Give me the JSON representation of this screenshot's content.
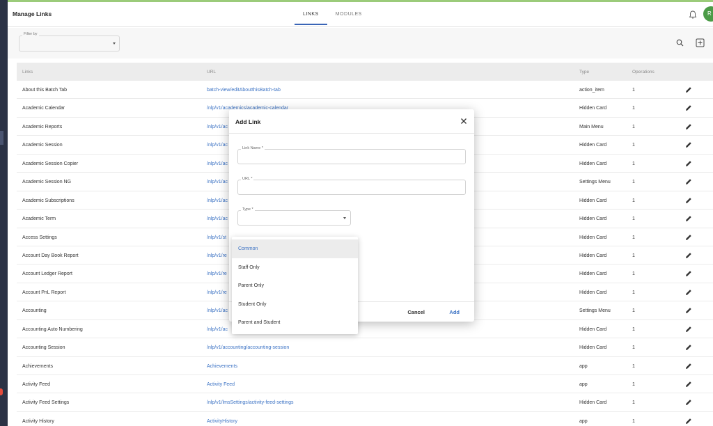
{
  "header": {
    "title": "Manage Links",
    "tabs": [
      {
        "label": "LINKS"
      },
      {
        "label": "MODULES"
      }
    ],
    "avatar_initial": "R"
  },
  "filter": {
    "label": "Filter by"
  },
  "table": {
    "columns": [
      "Links",
      "URL",
      "Type",
      "Operations"
    ],
    "rows": [
      {
        "name": "About this Batch Tab",
        "url": "batch-view/editAboutthisBatch-tab",
        "type": "action_item",
        "ops": "1"
      },
      {
        "name": "Academic Calendar",
        "url": "/nlp/v1/academics/academic-calendar",
        "type": "Hidden Card",
        "ops": "1"
      },
      {
        "name": "Academic Reports",
        "url": "/nlp/v1/ac",
        "type": "Main Menu",
        "ops": "1"
      },
      {
        "name": "Academic Session",
        "url": "/nlp/v1/ac",
        "type": "Hidden Card",
        "ops": "1"
      },
      {
        "name": "Academic Session Copier",
        "url": "/nlp/v1/ac",
        "type": "Hidden Card",
        "ops": "1"
      },
      {
        "name": "Academic Session NG",
        "url": "/nlp/v1/ac",
        "type": "Settings Menu",
        "ops": "1"
      },
      {
        "name": "Academic Subscriptions",
        "url": "/nlp/v1/ac",
        "type": "Hidden Card",
        "ops": "1"
      },
      {
        "name": "Academic Term",
        "url": "/nlp/v1/ac",
        "type": "Hidden Card",
        "ops": "1"
      },
      {
        "name": "Access Settings",
        "url": "/nlp/v1/st",
        "type": "Hidden Card",
        "ops": "1"
      },
      {
        "name": "Account Day Book Report",
        "url": "/nlp/v1/re",
        "type": "Hidden Card",
        "ops": "1"
      },
      {
        "name": "Account Ledger Report",
        "url": "/nlp/v1/re",
        "type": "Hidden Card",
        "ops": "1"
      },
      {
        "name": "Account PnL Report",
        "url": "/nlp/v1/re",
        "type": "Hidden Card",
        "ops": "1"
      },
      {
        "name": "Accounting",
        "url": "/nlp/v1/ac",
        "type": "Settings Menu",
        "ops": "1"
      },
      {
        "name": "Accounting Auto Numbering",
        "url": "/nlp/v1/ac",
        "type": "Hidden Card",
        "ops": "1"
      },
      {
        "name": "Accounting Session",
        "url": "/nlp/v1/accounting/accounting-session",
        "type": "Hidden Card",
        "ops": "1"
      },
      {
        "name": "Achievements",
        "url": "Achievements",
        "type": "app",
        "ops": "1"
      },
      {
        "name": "Activity Feed",
        "url": "Activity Feed",
        "type": "app",
        "ops": "1"
      },
      {
        "name": "Activity Feed Settings",
        "url": "/nlp/v1/lmsSettings/activity-feed-settings",
        "type": "Hidden Card",
        "ops": "1"
      },
      {
        "name": "Activity History",
        "url": "ActivityHistory",
        "type": "app",
        "ops": "1"
      }
    ]
  },
  "modal": {
    "title": "Add Link",
    "link_name_label": "Link Name *",
    "url_label": "URL *",
    "type_label": "Type *",
    "cancel": "Cancel",
    "add": "Add"
  },
  "dropdown": {
    "options": [
      "Common",
      "Staff Only",
      "Parent Only",
      "Student Only",
      "Parent and Student"
    ],
    "selected": "Common"
  },
  "colors": {
    "accent": "#3b72c4",
    "sidebar": "#2b3245",
    "avatar": "#4b9b47"
  }
}
